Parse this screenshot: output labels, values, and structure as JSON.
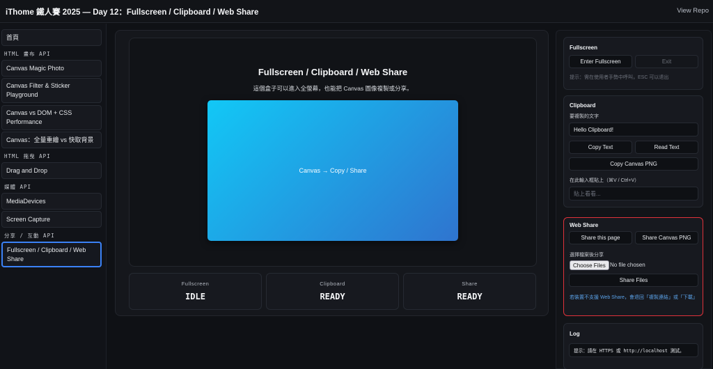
{
  "header": {
    "title": "iThome 鐵人賽 2025 — Day 12：Fullscreen / Clipboard / Web Share",
    "view_repo": "View Repo"
  },
  "sidebar": {
    "home": "首頁",
    "sections": [
      {
        "label": "HTML 畫布 API"
      },
      {
        "label": "HTML 拖曳 API"
      },
      {
        "label": "媒體 API"
      },
      {
        "label": "分享 / 互動 API"
      }
    ],
    "items": [
      {
        "label": "Canvas Magic Photo"
      },
      {
        "label": "Canvas Filter & Sticker Playground"
      },
      {
        "label": "Canvas vs DOM + CSS Performance"
      },
      {
        "label": "Canvas：全量重繪 vs 快取背景"
      },
      {
        "label": "Drag and Drop"
      },
      {
        "label": "MediaDevices"
      },
      {
        "label": "Screen Capture"
      },
      {
        "label": "Fullscreen / Clipboard / Web Share"
      }
    ]
  },
  "stage": {
    "title": "Fullscreen / Clipboard / Web Share",
    "subtitle": "這個盒子可以進入全螢幕，也能把 Canvas 圖像複製或分享。",
    "canvas_text": "Canvas → Copy / Share"
  },
  "status": [
    {
      "label": "Fullscreen",
      "value": "IDLE"
    },
    {
      "label": "Clipboard",
      "value": "READY"
    },
    {
      "label": "Share",
      "value": "READY"
    }
  ],
  "fullscreen_panel": {
    "title": "Fullscreen",
    "enter": "Enter Fullscreen",
    "exit": "Exit",
    "hint": "提示：需在使用者手勢中呼叫，ESC 可以退出"
  },
  "clipboard_panel": {
    "title": "Clipboard",
    "text_label": "要複製的文字",
    "text_value": "Hello Clipboard!",
    "copy_text": "Copy Text",
    "read_text": "Read Text",
    "copy_canvas": "Copy Canvas PNG",
    "paste_label": "在此輸入框貼上（⌘V / Ctrl+V）",
    "paste_placeholder": "貼上看看..."
  },
  "share_panel": {
    "title": "Web Share",
    "share_page": "Share this page",
    "share_canvas": "Share Canvas PNG",
    "files_label": "選擇檔案後分享",
    "choose_files": "Choose Files",
    "no_file": "No file chosen",
    "share_files": "Share Files",
    "warning": "若裝置不支援 Web Share，會退回「複製連結」或「下載」"
  },
  "log_panel": {
    "title": "Log",
    "content": "提示：請在 HTTPS 或 http://localhost 測試。"
  },
  "colors": {
    "accent": "#3b82f6",
    "highlight_border": "#e0323a",
    "gradient_start": "#12c8f6",
    "gradient_end": "#2f74cf"
  }
}
